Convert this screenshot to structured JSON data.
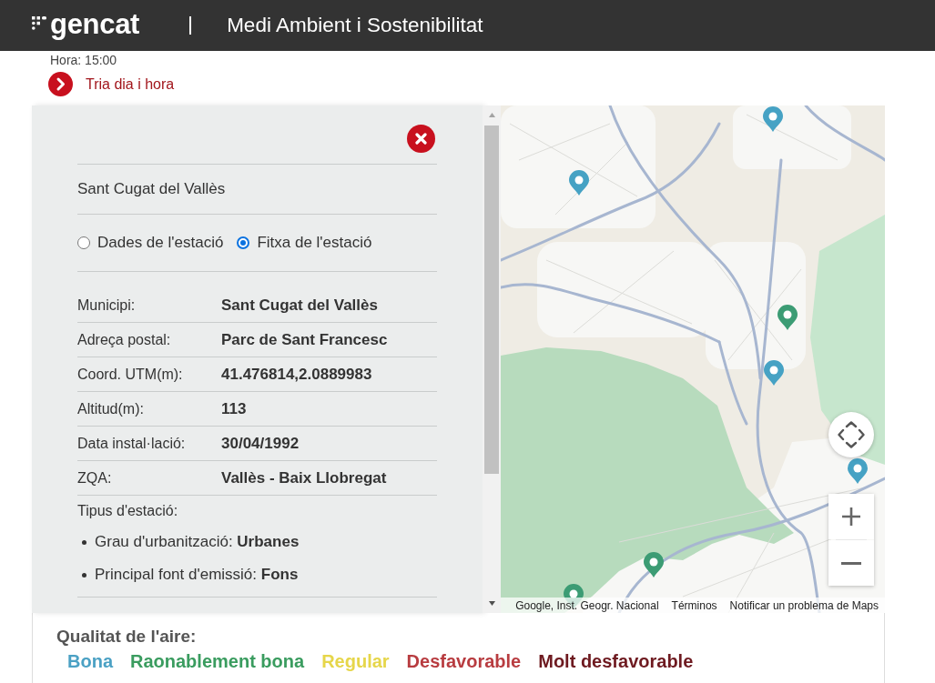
{
  "header": {
    "logo": "gencat",
    "title": "Medi Ambient i Sostenibilitat"
  },
  "time": {
    "label": "Hora: 15:00"
  },
  "date_link": {
    "label": "Tria dia i hora"
  },
  "station_panel": {
    "title": "Sant Cugat del Vallès",
    "views": [
      {
        "label": "Dades de l'estació",
        "selected": false
      },
      {
        "label": "Fitxa de l'estació",
        "selected": true
      }
    ],
    "fields": [
      {
        "label": "Municipi:",
        "value": "Sant Cugat del Vallès"
      },
      {
        "label": "Adreça postal:",
        "value": "Parc de Sant Francesc"
      },
      {
        "label": "Coord. UTM(m):",
        "value": "41.476814,2.0889983"
      },
      {
        "label": "Altitud(m):",
        "value": "113"
      },
      {
        "label": "Data instal·lació:",
        "value": "30/04/1992"
      },
      {
        "label": "ZQA:",
        "value": "Vallès - Baix Llobregat"
      }
    ],
    "type_heading": "Tipus d'estació:",
    "type_items": [
      "Grau d'urbanització: **Urbanes**",
      "Principal font d'emissió: **Fons**"
    ]
  },
  "map": {
    "stations": [
      {
        "color": "#46a2c4"
      },
      {
        "color": "#46a2c4"
      },
      {
        "color": "#3c9c74"
      },
      {
        "color": "#46a2c4"
      },
      {
        "color": "#46a2c4"
      },
      {
        "color": "#3c9c74"
      },
      {
        "color": "#3c9c74"
      }
    ],
    "attribution": "Google, Inst. Geogr. Nacional",
    "links": [
      "Términos",
      "Notificar un problema de Maps"
    ]
  },
  "legend": {
    "title": "Qualitat de l'aire:",
    "levels": [
      {
        "label": "Bona",
        "color": "#4ba1c4"
      },
      {
        "label": "Raonablement bona",
        "color": "#3a9c5f"
      },
      {
        "label": "Regular",
        "color": "#e6d64a"
      },
      {
        "label": "Desfavorable",
        "color": "#b83c40"
      },
      {
        "label": "Molt desfavorable",
        "color": "#6e1a20"
      }
    ]
  }
}
